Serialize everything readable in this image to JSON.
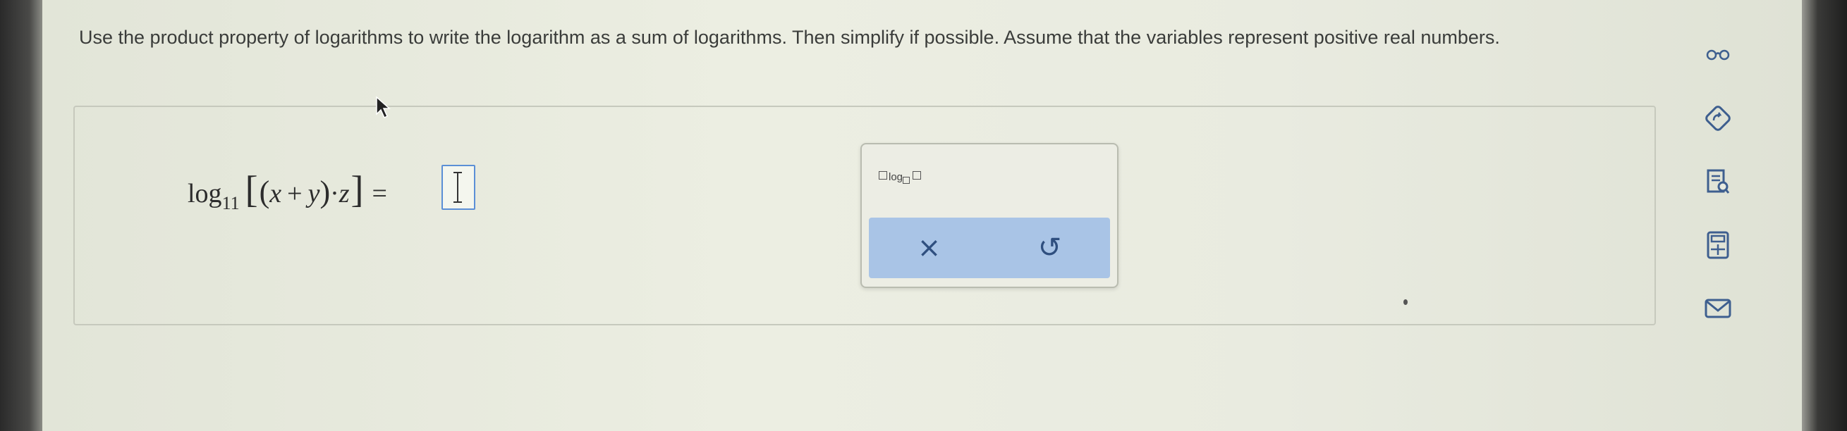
{
  "question": {
    "text": "Use the product property of logarithms to write the logarithm as a sum of logarithms. Then simplify if possible. Assume that the variables represent positive real numbers."
  },
  "equation": {
    "log": "log",
    "base": "11",
    "open_bracket": "[",
    "open_paren": "(",
    "x": "x",
    "plus": "+",
    "y": "y",
    "close_paren": ")",
    "dot": "·",
    "z": "z",
    "close_bracket": "]",
    "equals": "="
  },
  "palette": {
    "log_template_label": "log",
    "clear_symbol": "×",
    "undo_symbol": "↺"
  },
  "side_tools": [
    {
      "icon": "glasses-icon"
    },
    {
      "icon": "refresh-diamond-icon"
    },
    {
      "icon": "document-search-icon"
    },
    {
      "icon": "calculator-icon"
    },
    {
      "icon": "mail-icon"
    }
  ],
  "colors": {
    "accent": "#5b8fd6",
    "palette_bar": "#a9c4e6",
    "tool_icon": "#3e5f8f"
  }
}
